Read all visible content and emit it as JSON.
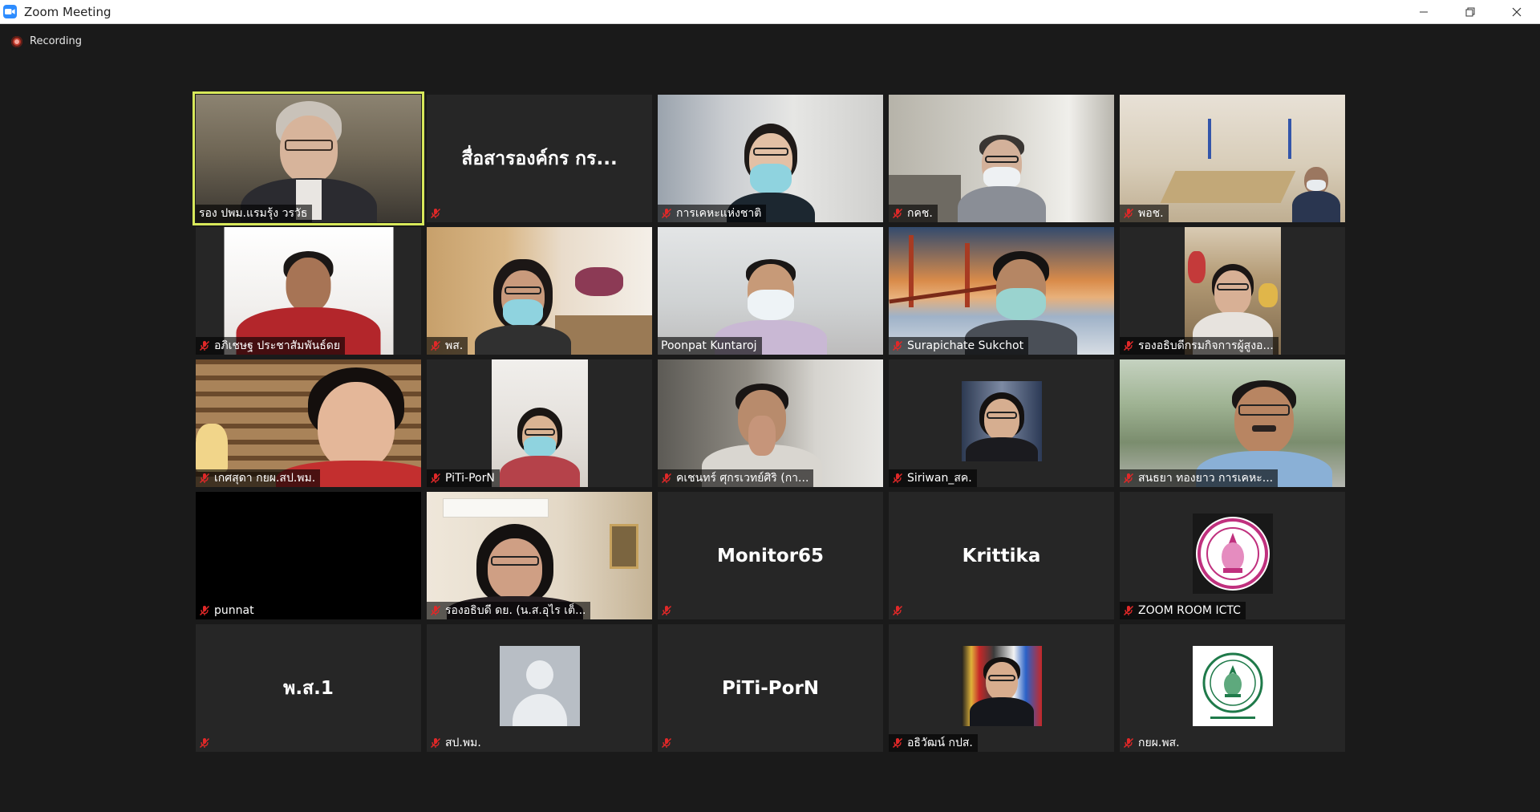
{
  "window": {
    "title": "Zoom Meeting",
    "icon": "zoom-camera-icon",
    "controls": [
      "minimize",
      "restore",
      "close"
    ]
  },
  "recording": {
    "label": "Recording",
    "icon": "recording-dot-icon"
  },
  "colors": {
    "active_speaker": "#d7e85a",
    "mute": "#e02828",
    "background": "#1a1a1a",
    "tile": "#262626"
  },
  "participants": [
    {
      "name": "รอง ปพม.แรมรุ้ง วรวัธ",
      "muted": false,
      "video": "full",
      "active": true
    },
    {
      "name": "",
      "display_name": "สื่อสารองค์กร กร...",
      "muted": true,
      "video": "off"
    },
    {
      "name": "การเคหะแห่งชาติ",
      "muted": true,
      "video": "full"
    },
    {
      "name": "กคช.",
      "muted": true,
      "video": "full"
    },
    {
      "name": "พอช.",
      "muted": true,
      "video": "full"
    },
    {
      "name": "อภิเชษฐ ประชาสัมพันธ์ดย",
      "muted": true,
      "video": "center"
    },
    {
      "name": "พส.",
      "muted": true,
      "video": "full"
    },
    {
      "name": "Poonpat Kuntaroj",
      "muted": false,
      "video": "full"
    },
    {
      "name": "Surapichate Sukchot",
      "muted": true,
      "video": "full"
    },
    {
      "name": "รองอธิบดีกรมกิจการผู้สูงอ...",
      "muted": true,
      "video": "center"
    },
    {
      "name": "เกศสุดา กยผ.สป.พม.",
      "muted": true,
      "video": "full"
    },
    {
      "name": "PiTi-PorN",
      "muted": true,
      "video": "center"
    },
    {
      "name": "คเชนทร์ ศุกรเวทย์ศิริ (กา...",
      "muted": true,
      "video": "full"
    },
    {
      "name": "Siriwan_สค.",
      "muted": true,
      "video": "avatar"
    },
    {
      "name": "สนธยา ทองยาว การเคหะ...",
      "muted": true,
      "video": "full"
    },
    {
      "name": "punnat",
      "muted": true,
      "video": "black"
    },
    {
      "name": "รองอธิบดี ดย. (น.ส.อุไร เต็...",
      "muted": true,
      "video": "full"
    },
    {
      "name": "",
      "display_name": "Monitor65",
      "muted": true,
      "video": "off"
    },
    {
      "name": "",
      "display_name": "Krittika",
      "muted": true,
      "video": "off"
    },
    {
      "name": "ZOOM ROOM ICTC",
      "muted": true,
      "video": "seal-pink"
    },
    {
      "name": "",
      "display_name": "พ.ส.1",
      "muted": true,
      "video": "off"
    },
    {
      "name": "สป.พม.",
      "muted": true,
      "video": "generic-avatar"
    },
    {
      "name": "",
      "display_name": "PiTi-PorN",
      "muted": true,
      "video": "off"
    },
    {
      "name": "อธิวัฒน์ กปส.",
      "muted": true,
      "video": "avatar"
    },
    {
      "name": "กยผ.พส.",
      "muted": true,
      "video": "seal-green"
    }
  ]
}
